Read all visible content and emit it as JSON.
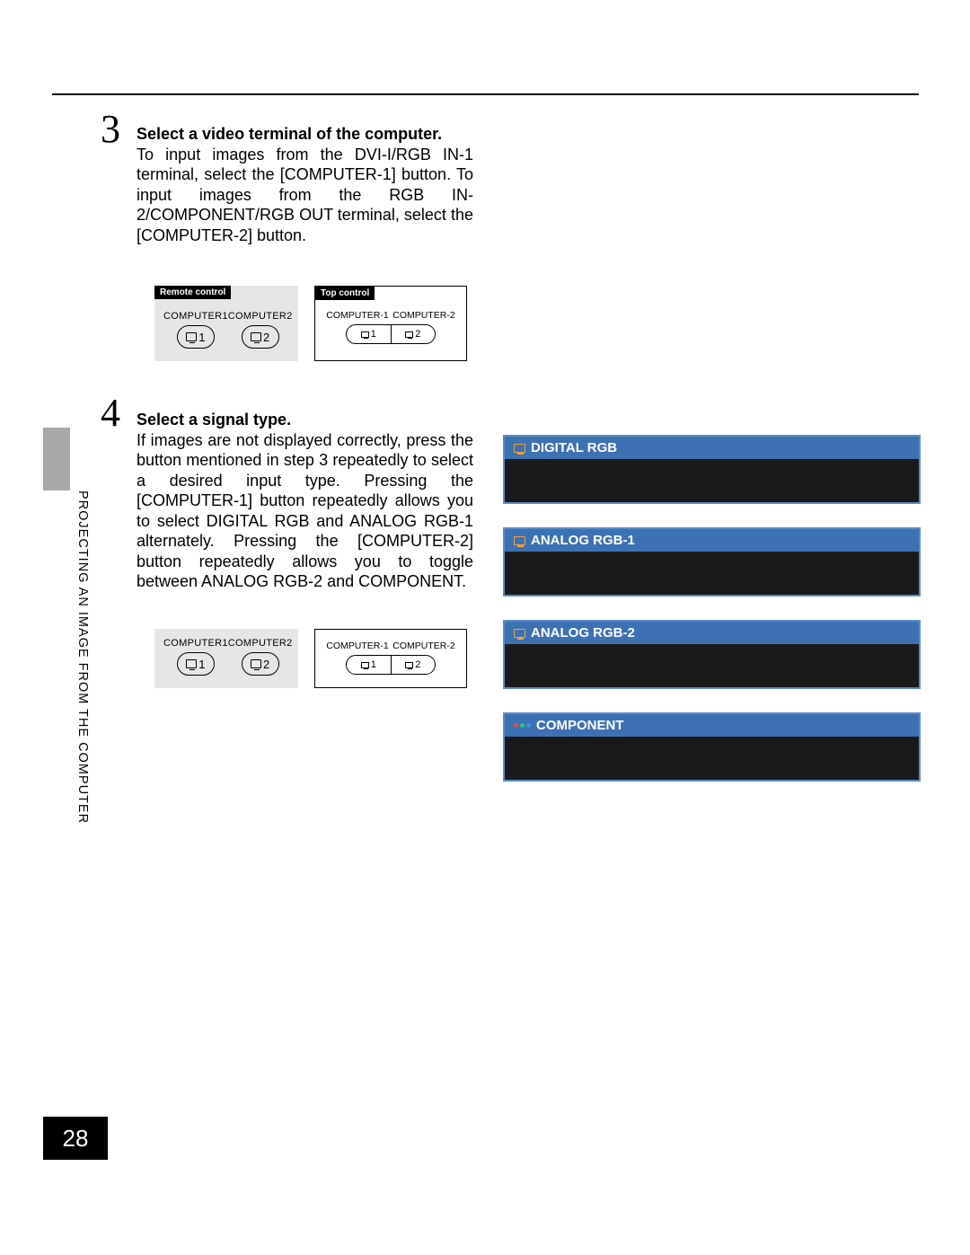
{
  "side_label": "PROJECTING AN IMAGE FROM THE COMPUTER",
  "page_number": "28",
  "step3": {
    "number": "3",
    "title": "Select a video terminal of the computer.",
    "body": "To input images from the DVI-I/RGB IN-1 terminal, select the [COMPUTER-1] button. To input images from the RGB IN-2/COMPONENT/RGB OUT terminal, select the [COMPUTER-2] button."
  },
  "step4": {
    "number": "4",
    "title": "Select a signal type.",
    "body": "If images are not displayed correctly, press the button mentioned in step 3 repeatedly to select a desired input type. Pressing the [COMPUTER-1] button repeatedly allows you to select DIGITAL RGB and ANALOG RGB-1 alternately. Pressing the [COMPUTER-2] button repeatedly allows you to toggle between ANALOG RGB-2 and COMPONENT."
  },
  "controls": {
    "remote_label": "Remote control",
    "top_label": "Top control",
    "computer1_label": "COMPUTER1",
    "computer2_label": "COMPUTER2",
    "top_comp1": "COMPUTER-1",
    "top_comp2": "COMPUTER-2",
    "btn1": "1",
    "btn2": "2"
  },
  "signals": [
    {
      "label": "DIGITAL RGB",
      "icon": "monitor"
    },
    {
      "label": "ANALOG RGB-1",
      "icon": "monitor"
    },
    {
      "label": "ANALOG RGB-2",
      "icon": "monitor"
    },
    {
      "label": "COMPONENT",
      "icon": "component"
    }
  ]
}
